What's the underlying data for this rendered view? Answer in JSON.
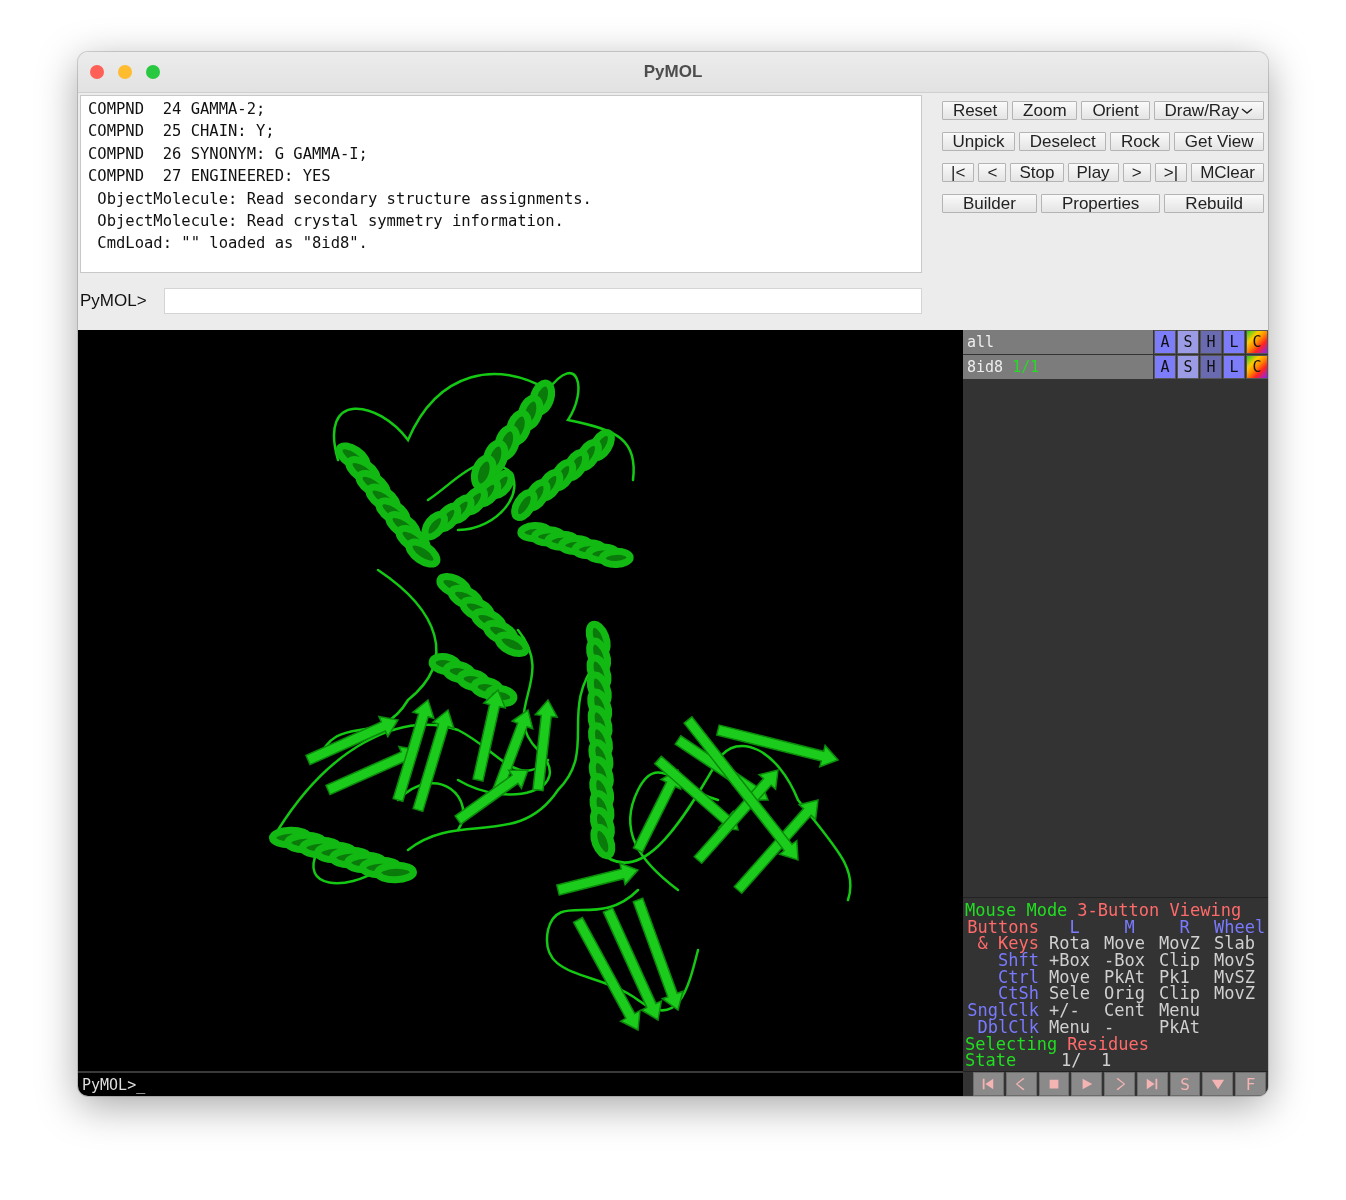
{
  "window": {
    "title": "PyMOL"
  },
  "console": {
    "lines": [
      "COMPND  24 GAMMA-2;",
      "COMPND  25 CHAIN: Y;",
      "COMPND  26 SYNONYM: G GAMMA-I;",
      "COMPND  27 ENGINEERED: YES",
      " ObjectMolecule: Read secondary structure assignments.",
      " ObjectMolecule: Read crystal symmetry information.",
      " CmdLoad: \"\" loaded as \"8id8\"."
    ]
  },
  "command": {
    "prompt": "PyMOL>"
  },
  "button_rows": [
    [
      {
        "label": "Reset",
        "kind": "plain"
      },
      {
        "label": "Zoom",
        "kind": "plain"
      },
      {
        "label": "Orient",
        "kind": "plain"
      },
      {
        "label": "Draw/Ray",
        "kind": "menu"
      }
    ],
    [
      {
        "label": "Unpick",
        "kind": "plain"
      },
      {
        "label": "Deselect",
        "kind": "plain"
      },
      {
        "label": "Rock",
        "kind": "plain"
      },
      {
        "label": "Get View",
        "kind": "plain"
      }
    ],
    [
      {
        "label": "|<",
        "kind": "plain"
      },
      {
        "label": "<",
        "kind": "plain"
      },
      {
        "label": "Stop",
        "kind": "plain"
      },
      {
        "label": "Play",
        "kind": "plain"
      },
      {
        "label": ">",
        "kind": "plain"
      },
      {
        "label": ">|",
        "kind": "plain"
      },
      {
        "label": "MClear",
        "kind": "plain"
      }
    ],
    [
      {
        "label": "Builder",
        "kind": "plain"
      },
      {
        "label": "Properties",
        "kind": "plain"
      },
      {
        "label": "Rebuild",
        "kind": "plain"
      }
    ]
  ],
  "objects": [
    {
      "name": "all",
      "buttons": [
        {
          "label": "A",
          "kind": "action"
        },
        {
          "label": "S",
          "kind": "show"
        },
        {
          "label": "H",
          "kind": "hide"
        },
        {
          "label": "L",
          "kind": "label"
        },
        {
          "label": "C",
          "kind": "color"
        }
      ]
    },
    {
      "name": "8id8",
      "state": "1/1",
      "buttons": [
        {
          "label": "A",
          "kind": "action"
        },
        {
          "label": "S",
          "kind": "show"
        },
        {
          "label": "H",
          "kind": "hide"
        },
        {
          "label": "L",
          "kind": "label"
        },
        {
          "label": "C",
          "kind": "color"
        }
      ]
    }
  ],
  "viewer": {
    "prompt": "PyMOL>_"
  },
  "mouse_mode": {
    "label": "Mouse Mode",
    "mode": "3-Button Viewing",
    "rows": [
      {
        "label": "Buttons",
        "kind": "header",
        "cells": [
          "L",
          "M",
          "R",
          "Wheel"
        ]
      },
      {
        "label": "& Keys",
        "kind": "keys",
        "cells": [
          "Rota",
          "Move",
          "MovZ",
          "Slab"
        ]
      },
      {
        "label": "Shft",
        "kind": "modifier",
        "cells": [
          "+Box",
          "-Box",
          "Clip",
          "MovS"
        ]
      },
      {
        "label": "Ctrl",
        "kind": "modifier",
        "cells": [
          "Move",
          "PkAt",
          "Pk1",
          "MvSZ"
        ]
      },
      {
        "label": "CtSh",
        "kind": "modifier",
        "cells": [
          "Sele",
          "Orig",
          "Clip",
          "MovZ"
        ]
      },
      {
        "label": "SnglClk",
        "kind": "modifier",
        "cells": [
          "+/-",
          "Cent",
          "Menu"
        ]
      },
      {
        "label": "DblClk",
        "kind": "modifier",
        "cells": [
          "Menu",
          "-",
          "PkAt"
        ]
      }
    ],
    "selecting": {
      "label": "Selecting",
      "value": "Residues"
    },
    "state": {
      "label": "State",
      "current": "1/",
      "total": "1"
    }
  },
  "transport": [
    {
      "kind": "first"
    },
    {
      "kind": "prev"
    },
    {
      "kind": "stop"
    },
    {
      "kind": "play"
    },
    {
      "kind": "next"
    },
    {
      "kind": "last"
    },
    {
      "kind": "text",
      "label": "S"
    },
    {
      "kind": "menu"
    },
    {
      "kind": "text",
      "label": "F"
    }
  ]
}
